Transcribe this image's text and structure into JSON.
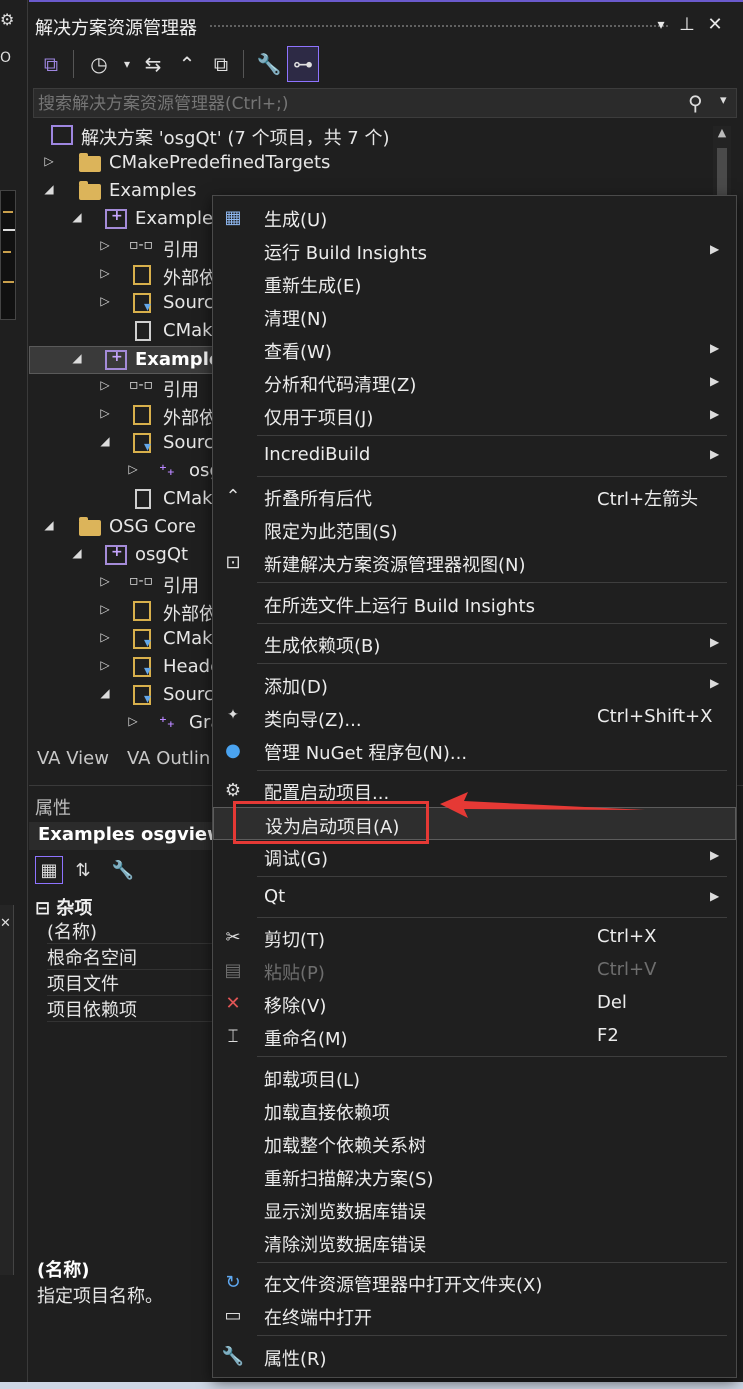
{
  "panel": {
    "title": "解决方案资源管理器",
    "controls": {
      "dropdown": "▾",
      "pin": "📌",
      "close": "✕"
    }
  },
  "search": {
    "placeholder": "搜索解决方案资源管理器(Ctrl+;)"
  },
  "tree": [
    {
      "label": "解决方案 'osgQt' (7 个项目，共 7 个)",
      "type": "solution"
    },
    {
      "label": "CMakePredefinedTargets",
      "type": "folder"
    },
    {
      "label": "Examples",
      "type": "folder"
    },
    {
      "label": "Examples",
      "type": "project"
    },
    {
      "label": "引用",
      "type": "ref"
    },
    {
      "label": "外部依",
      "type": "ext"
    },
    {
      "label": "Sourc",
      "type": "filter"
    },
    {
      "label": "CMak",
      "type": "file"
    },
    {
      "label": "Example",
      "type": "project",
      "selected": true
    },
    {
      "label": "引用",
      "type": "ref"
    },
    {
      "label": "外部依",
      "type": "ext"
    },
    {
      "label": "Sourc",
      "type": "filter"
    },
    {
      "label": "osg",
      "type": "cpp"
    },
    {
      "label": "CMak",
      "type": "file"
    },
    {
      "label": "OSG Core",
      "type": "folder"
    },
    {
      "label": "osgQt",
      "type": "project"
    },
    {
      "label": "引用",
      "type": "ref"
    },
    {
      "label": "外部依",
      "type": "ext"
    },
    {
      "label": "CMak",
      "type": "filter"
    },
    {
      "label": "Heade",
      "type": "filter"
    },
    {
      "label": "Sourc",
      "type": "filter"
    },
    {
      "label": "Gra",
      "type": "cpp"
    }
  ],
  "tabs": {
    "va_view": "VA View",
    "va_outline": "VA Outlin"
  },
  "properties": {
    "title": "属性",
    "object": "Examples osgviewe",
    "category": "杂项",
    "rows": [
      "(名称)",
      "根命名空间",
      "项目文件",
      "项目依赖项"
    ],
    "desc_title": "(名称)",
    "desc_text": "指定项目名称。"
  },
  "left_strip": {
    "o": "O"
  },
  "menu": [
    {
      "label": "生成(U)",
      "icon": "build-icon"
    },
    {
      "label": "运行 Build Insights",
      "submenu": true
    },
    {
      "label": "重新生成(E)"
    },
    {
      "label": "清理(N)"
    },
    {
      "label": "查看(W)",
      "submenu": true
    },
    {
      "label": "分析和代码清理(Z)",
      "submenu": true
    },
    {
      "label": "仅用于项目(J)",
      "submenu": true
    },
    {
      "label": "IncrediBuild",
      "submenu": true
    },
    {
      "label": "折叠所有后代",
      "shortcut": "Ctrl+左箭头",
      "icon": "collapse-icon"
    },
    {
      "label": "限定为此范围(S)"
    },
    {
      "label": "新建解决方案资源管理器视图(N)",
      "icon": "new-view-icon"
    },
    {
      "label": "在所选文件上运行 Build Insights"
    },
    {
      "label": "生成依赖项(B)",
      "submenu": true
    },
    {
      "label": "添加(D)",
      "submenu": true
    },
    {
      "label": "类向导(Z)...",
      "shortcut": "Ctrl+Shift+X",
      "icon": "class-wizard-icon"
    },
    {
      "label": "管理 NuGet 程序包(N)...",
      "icon": "nuget-icon"
    },
    {
      "label": "配置启动项目...",
      "icon": "gear-icon"
    },
    {
      "label": "设为启动项目(A)",
      "highlighted": true
    },
    {
      "label": "调试(G)",
      "submenu": true
    },
    {
      "label": "Qt",
      "submenu": true
    },
    {
      "label": "剪切(T)",
      "shortcut": "Ctrl+X",
      "icon": "cut-icon"
    },
    {
      "label": "粘贴(P)",
      "shortcut": "Ctrl+V",
      "icon": "paste-icon",
      "disabled": true
    },
    {
      "label": "移除(V)",
      "shortcut": "Del",
      "icon": "remove-icon"
    },
    {
      "label": "重命名(M)",
      "shortcut": "F2",
      "icon": "rename-icon"
    },
    {
      "label": "卸载项目(L)"
    },
    {
      "label": "加载直接依赖项"
    },
    {
      "label": "加载整个依赖关系树"
    },
    {
      "label": "重新扫描解决方案(S)"
    },
    {
      "label": "显示浏览数据库错误"
    },
    {
      "label": "清除浏览数据库错误"
    },
    {
      "label": "在文件资源管理器中打开文件夹(X)",
      "icon": "open-folder-icon"
    },
    {
      "label": "在终端中打开",
      "icon": "terminal-icon"
    },
    {
      "label": "属性(R)",
      "icon": "wrench-icon"
    }
  ],
  "colors": {
    "accent": "#8e73ff",
    "annotation_red": "#e53935"
  }
}
